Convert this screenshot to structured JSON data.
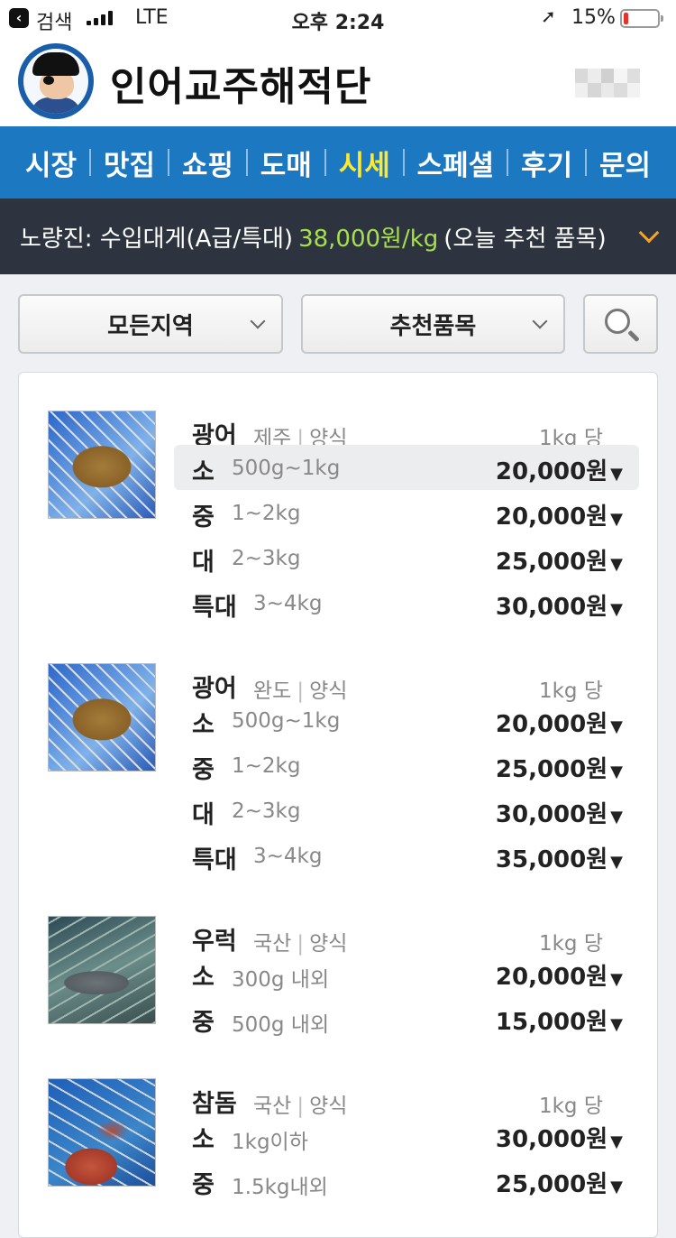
{
  "status": {
    "back_label": "검색",
    "network": "LTE",
    "time": "오후 2:24",
    "battery": "15%",
    "battery_level": 0.15
  },
  "header": {
    "brand": "인어교주해적단"
  },
  "nav": {
    "items": [
      {
        "label": "시장",
        "active": false
      },
      {
        "label": "맛집",
        "active": false
      },
      {
        "label": "쇼핑",
        "active": false
      },
      {
        "label": "도매",
        "active": false
      },
      {
        "label": "시세",
        "active": true
      },
      {
        "label": "스페셜",
        "active": false
      },
      {
        "label": "후기",
        "active": false
      },
      {
        "label": "문의",
        "active": false
      }
    ]
  },
  "ticker": {
    "prefix": "노량진: 수입대게(A급/특대)",
    "price": "38,000원/kg",
    "suffix": "(오늘 추천 품목)"
  },
  "filters": {
    "region": "모든지역",
    "item": "추천품목"
  },
  "products": [
    {
      "name": "광어",
      "origin": "제주",
      "type": "양식",
      "unit": "1kg 당",
      "rows": [
        {
          "size": "소",
          "weight": "500g~1kg",
          "price": "20,000원"
        },
        {
          "size": "중",
          "weight": "1~2kg",
          "price": "20,000원"
        },
        {
          "size": "대",
          "weight": "2~3kg",
          "price": "25,000원"
        },
        {
          "size": "특대",
          "weight": "3~4kg",
          "price": "30,000원"
        }
      ]
    },
    {
      "name": "광어",
      "origin": "완도",
      "type": "양식",
      "unit": "1kg 당",
      "rows": [
        {
          "size": "소",
          "weight": "500g~1kg",
          "price": "20,000원"
        },
        {
          "size": "중",
          "weight": "1~2kg",
          "price": "25,000원"
        },
        {
          "size": "대",
          "weight": "2~3kg",
          "price": "30,000원"
        },
        {
          "size": "특대",
          "weight": "3~4kg",
          "price": "35,000원"
        }
      ]
    },
    {
      "name": "우럭",
      "origin": "국산",
      "type": "양식",
      "unit": "1kg 당",
      "rows": [
        {
          "size": "소",
          "weight": "300g 내외",
          "price": "20,000원"
        },
        {
          "size": "중",
          "weight": "500g 내외",
          "price": "15,000원"
        }
      ]
    },
    {
      "name": "참돔",
      "origin": "국산",
      "type": "양식",
      "unit": "1kg 당",
      "rows": [
        {
          "size": "소",
          "weight": "1kg이하",
          "price": "30,000원"
        },
        {
          "size": "중",
          "weight": "1.5kg내외",
          "price": "25,000원"
        }
      ]
    }
  ]
}
